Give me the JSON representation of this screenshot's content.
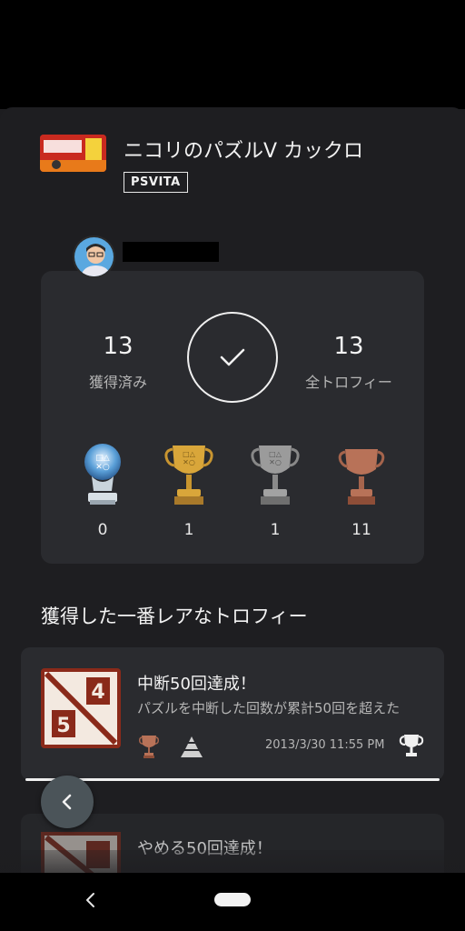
{
  "game": {
    "title": "ニコリのパズルV カックロ",
    "platform": "PSVITA"
  },
  "summary": {
    "earned_count": "13",
    "earned_label": "獲得済み",
    "total_count": "13",
    "total_label": "全トロフィー",
    "progress_percent": 100
  },
  "trophy_breakdown": [
    {
      "type": "platinum",
      "count": "0"
    },
    {
      "type": "gold",
      "count": "1"
    },
    {
      "type": "silver",
      "count": "1"
    },
    {
      "type": "bronze",
      "count": "11"
    }
  ],
  "rarest": {
    "section_title": "獲得した一番レアなトロフィー",
    "items": [
      {
        "name": "中断50回達成！",
        "description": "パズルを中断した回数が累計50回を超えた",
        "grade": "bronze",
        "rarity_icon": "pyramid-icon",
        "date": "2013/3/30  11:55 PM"
      },
      {
        "name": "やめる50回達成！"
      }
    ]
  },
  "colors": {
    "background": "#1d1d20",
    "card": "#2a2b2f",
    "fab": "#4b5459",
    "gold": "#d4a437",
    "silver": "#9a9a9a",
    "bronze": "#b8735a",
    "platinum": "#6aa7d6"
  }
}
